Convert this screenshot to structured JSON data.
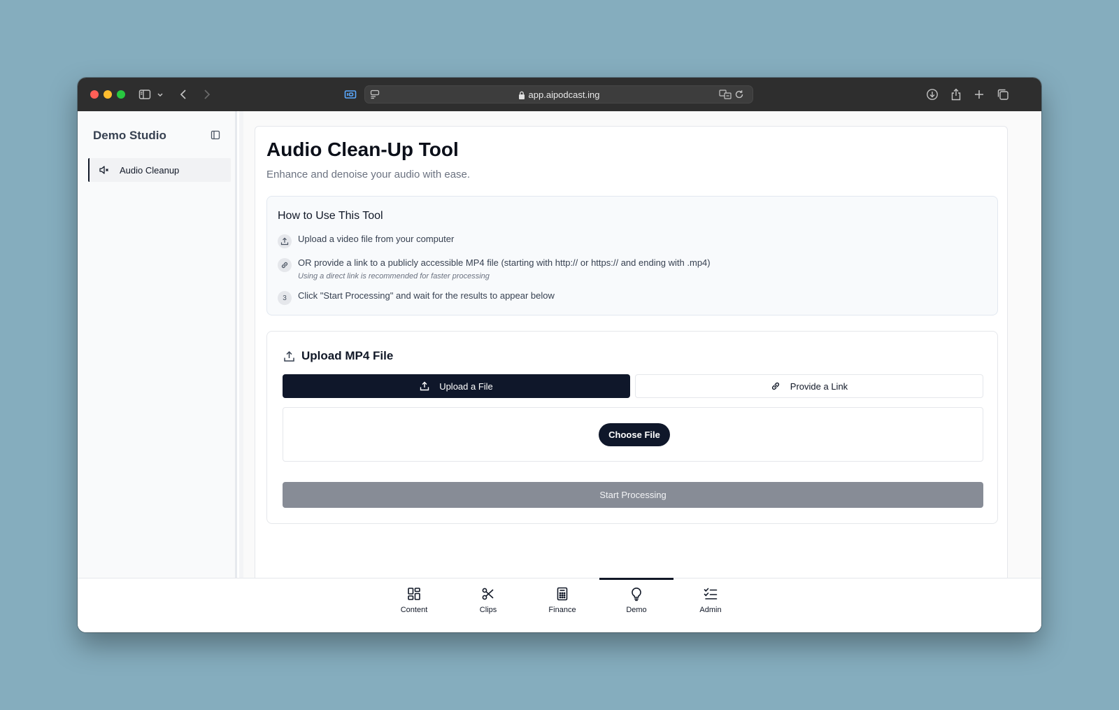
{
  "browser": {
    "url": "app.aipodcast.ing"
  },
  "sidebar": {
    "title": "Demo Studio",
    "items": [
      {
        "label": "Audio Cleanup",
        "icon": "volume-mute-icon",
        "active": true
      }
    ]
  },
  "main": {
    "title": "Audio Clean-Up Tool",
    "subtitle": "Enhance and denoise your audio with ease.",
    "howto": {
      "title": "How to Use This Tool",
      "steps": [
        {
          "text": "Upload a video file from your computer",
          "icon": "upload-icon"
        },
        {
          "text": "OR provide a link to a publicly accessible MP4 file (starting with http:// or https:// and ending with .mp4)",
          "note": "Using a direct link is recommended for faster processing",
          "icon": "link-icon"
        },
        {
          "badge": "3",
          "text": "Click \"Start Processing\" and wait for the results to appear below"
        }
      ]
    },
    "upload": {
      "title": "Upload MP4 File",
      "tab_upload": "Upload a File",
      "tab_link": "Provide a Link",
      "active_tab": "Upload a File",
      "choose_label": "Choose File",
      "start_label": "Start Processing"
    }
  },
  "bottom_nav": {
    "active": "Demo",
    "items": [
      {
        "label": "Content",
        "icon": "grid-icon"
      },
      {
        "label": "Clips",
        "icon": "scissors-icon"
      },
      {
        "label": "Finance",
        "icon": "calculator-icon"
      },
      {
        "label": "Demo",
        "icon": "lightbulb-icon"
      },
      {
        "label": "Admin",
        "icon": "checklist-icon"
      }
    ]
  },
  "colors": {
    "primary": "#0f172a",
    "disabled_button": "#878c96",
    "desktop": "#85adbe"
  }
}
